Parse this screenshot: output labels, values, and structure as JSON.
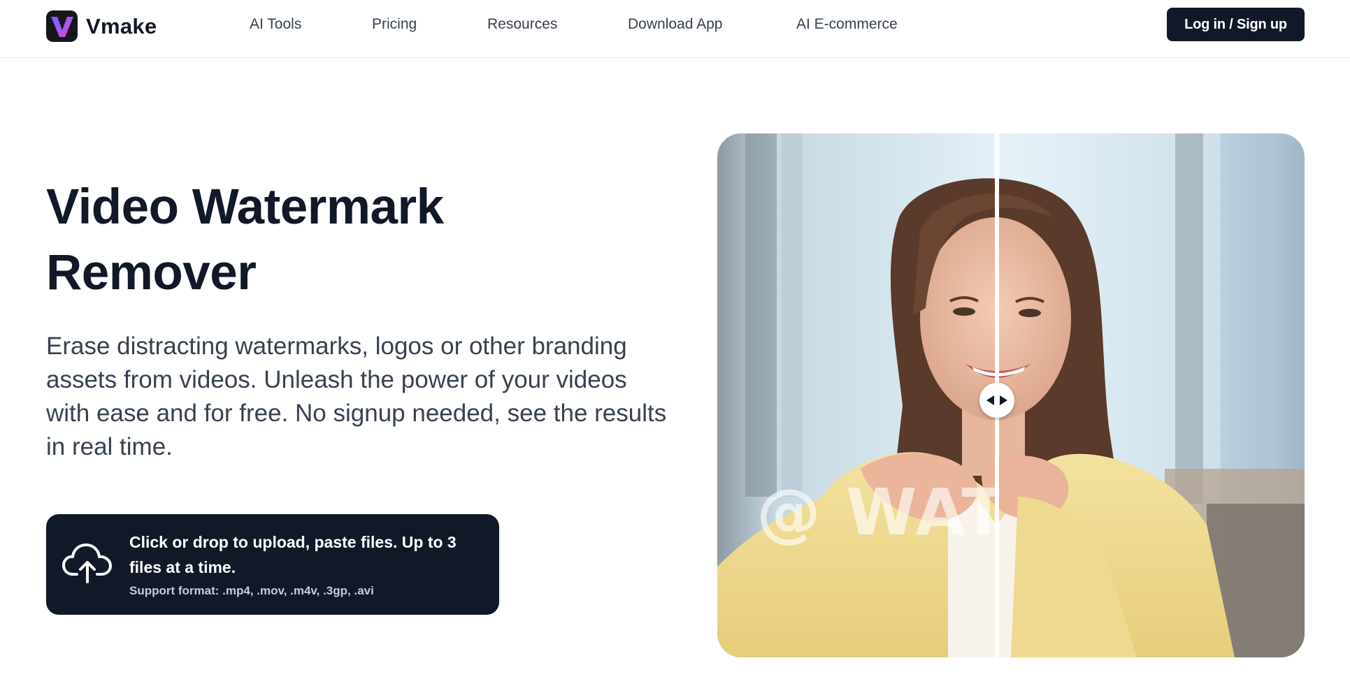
{
  "brand": {
    "name": "Vmake",
    "logo_letter": "V"
  },
  "nav": {
    "items": [
      {
        "label": "AI Tools"
      },
      {
        "label": "Pricing"
      },
      {
        "label": "Resources"
      },
      {
        "label": "Download App"
      },
      {
        "label": "AI E-commerce"
      }
    ],
    "login_label": "Log in / Sign up"
  },
  "hero": {
    "title": "Video Watermark Remover",
    "description": "Erase distracting watermarks, logos or other branding assets from videos. Unleash the power of your videos with ease and for free. No signup needed, see the results in real time."
  },
  "upload": {
    "main_text": "Click or drop to upload, paste files. Up to 3 files at a time.",
    "support_text": "Support format: .mp4, .mov, .m4v, .3gp, .avi",
    "icon": "cloud-upload-icon"
  },
  "compare": {
    "watermark_text": "@ WATE",
    "handle_icon": "drag-handle-arrows-icon"
  },
  "colors": {
    "primary_dark": "#111827",
    "logo_gradient_start": "#8b5cf6",
    "logo_gradient_end": "#ec4899",
    "text_body": "#374151"
  }
}
